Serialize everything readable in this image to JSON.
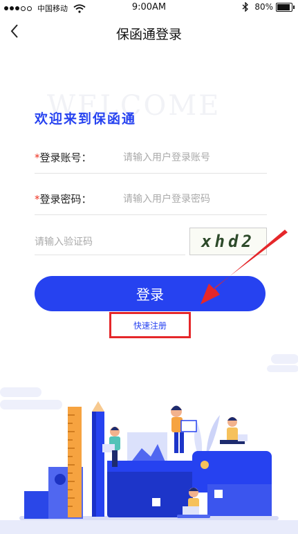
{
  "status_bar": {
    "carrier": "中国移动",
    "time": "9:00AM",
    "battery": "80%"
  },
  "nav": {
    "title": "保函通登录"
  },
  "welcome": {
    "watermark": "WELCOME",
    "heading": "欢迎来到保函通"
  },
  "form": {
    "account_label": "登录账号：",
    "account_placeholder": "请输入用户登录账号",
    "password_label": "登录密码：",
    "password_placeholder": "请输入用户登录密码",
    "captcha_placeholder": "请输入验证码",
    "captcha_text": "xhd2",
    "required_mark": "*"
  },
  "actions": {
    "login_label": "登录",
    "register_label": "快速注册"
  },
  "colors": {
    "primary": "#2642f0",
    "highlight": "#e5272a"
  }
}
